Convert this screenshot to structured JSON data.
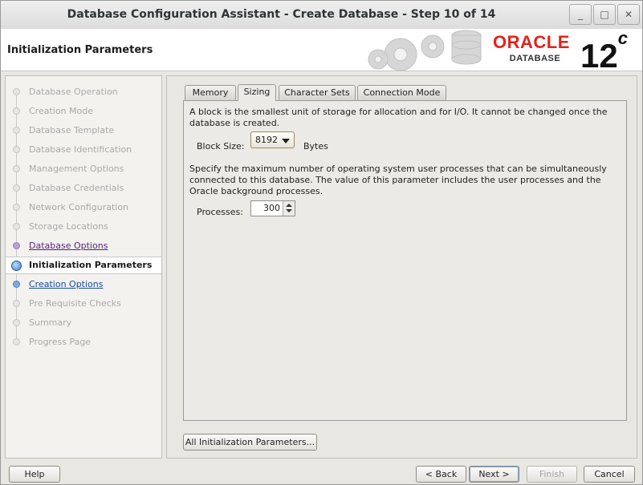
{
  "window": {
    "title": "Database Configuration Assistant - Create Database - Step 10 of 14",
    "controls": {
      "minimize": "_",
      "maximize": "□",
      "close": "✕"
    }
  },
  "header": {
    "title": "Initialization Parameters",
    "logo_word": "ORACLE",
    "logo_sub": "DATABASE",
    "version": "12",
    "version_sup": "c",
    "brand_color": "#e2231a"
  },
  "steps": [
    {
      "label": "Database Operation",
      "state": "done"
    },
    {
      "label": "Creation Mode",
      "state": "done"
    },
    {
      "label": "Database Template",
      "state": "done"
    },
    {
      "label": "Database Identification",
      "state": "done"
    },
    {
      "label": "Management Options",
      "state": "done"
    },
    {
      "label": "Database Credentials",
      "state": "done"
    },
    {
      "label": "Network Configuration",
      "state": "done"
    },
    {
      "label": "Storage Locations",
      "state": "done"
    },
    {
      "label": "Database Options",
      "state": "link"
    },
    {
      "label": "Initialization Parameters",
      "state": "active"
    },
    {
      "label": "Creation Options",
      "state": "next"
    },
    {
      "label": "Pre Requisite Checks",
      "state": "pending"
    },
    {
      "label": "Summary",
      "state": "pending"
    },
    {
      "label": "Progress Page",
      "state": "pending"
    }
  ],
  "tabs": [
    {
      "label": "Memory",
      "selected": false
    },
    {
      "label": "Sizing",
      "selected": true
    },
    {
      "label": "Character Sets",
      "selected": false
    },
    {
      "label": "Connection Mode",
      "selected": false
    }
  ],
  "sizing": {
    "block_desc": "A block is the smallest unit of storage for allocation and for I/O. It cannot be changed once the database is created.",
    "block_size_label": "Block Size:",
    "block_size_value": "8192",
    "block_size_unit": "Bytes",
    "processes_desc": "Specify the maximum number of operating system user processes that can be simultaneously connected to this database. The value of this parameter includes the user processes and the Oracle background processes.",
    "processes_label": "Processes:",
    "processes_value": "300"
  },
  "buttons": {
    "all_params": "All Initialization Parameters...",
    "help": "Help",
    "back": "< Back",
    "next": "Next >",
    "finish": "Finish",
    "cancel": "Cancel"
  }
}
